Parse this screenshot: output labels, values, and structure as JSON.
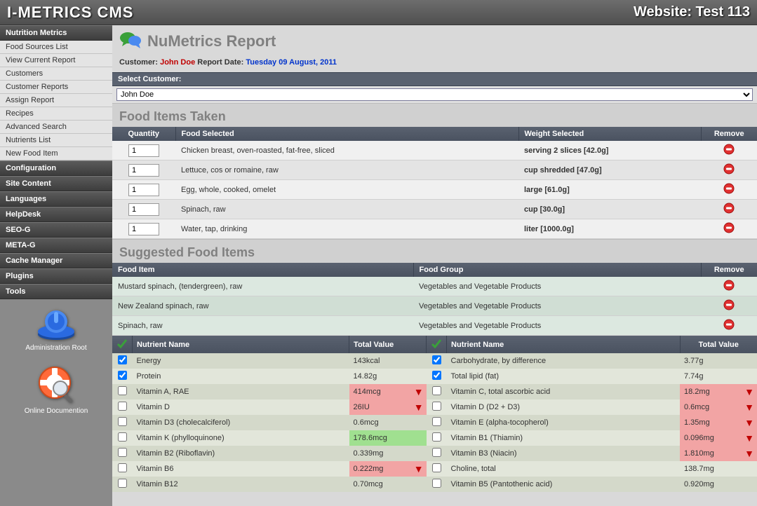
{
  "header": {
    "brand": "I-METRICS CMS",
    "site": "Website: Test 113"
  },
  "sidebar": {
    "sections": [
      {
        "title": "Nutrition Metrics",
        "items": [
          "Food Sources List",
          "View Current Report",
          "Customers",
          "Customer Reports",
          "Assign Report",
          "Recipes",
          "Advanced Search",
          "Nutrients List",
          "New Food Item"
        ]
      },
      {
        "title": "Configuration",
        "items": []
      },
      {
        "title": "Site Content",
        "items": []
      },
      {
        "title": "Languages",
        "items": []
      },
      {
        "title": "HelpDesk",
        "items": []
      },
      {
        "title": "SEO-G",
        "items": []
      },
      {
        "title": "META-G",
        "items": []
      },
      {
        "title": "Cache Manager",
        "items": []
      },
      {
        "title": "Plugins",
        "items": []
      },
      {
        "title": "Tools",
        "items": []
      }
    ],
    "footer1": "Administration Root",
    "footer2": "Online Documention"
  },
  "page": {
    "title": "NuMetrics Report",
    "customer_label": "Customer:",
    "customer_name": "John Doe",
    "date_label": "Report Date:",
    "date_value": "Tuesday 09 August, 2011",
    "select_label": "Select Customer:",
    "select_value": "John Doe"
  },
  "food_taken": {
    "title": "Food Items Taken",
    "cols": {
      "qty": "Quantity",
      "food": "Food Selected",
      "weight": "Weight Selected",
      "remove": "Remove"
    },
    "rows": [
      {
        "qty": "1",
        "food": "Chicken breast, oven-roasted, fat-free, sliced",
        "weight": "serving 2 slices [42.0g]"
      },
      {
        "qty": "1",
        "food": "Lettuce, cos or romaine, raw",
        "weight": "cup shredded [47.0g]"
      },
      {
        "qty": "1",
        "food": "Egg, whole, cooked, omelet",
        "weight": "large [61.0g]"
      },
      {
        "qty": "1",
        "food": "Spinach, raw",
        "weight": "cup [30.0g]"
      },
      {
        "qty": "1",
        "food": "Water, tap, drinking",
        "weight": "liter [1000.0g]"
      }
    ]
  },
  "suggested": {
    "title": "Suggested Food Items",
    "cols": {
      "item": "Food Item",
      "group": "Food Group",
      "remove": "Remove"
    },
    "rows": [
      {
        "item": "Mustard spinach, (tendergreen), raw",
        "group": "Vegetables and Vegetable Products"
      },
      {
        "item": "New Zealand spinach, raw",
        "group": "Vegetables and Vegetable Products"
      },
      {
        "item": "Spinach, raw",
        "group": "Vegetables and Vegetable Products"
      }
    ]
  },
  "nutrients": {
    "cols": {
      "name": "Nutrient Name",
      "value": "Total Value"
    },
    "pairs": [
      {
        "l": {
          "chk": true,
          "name": "Energy",
          "val": "143kcal",
          "status": ""
        },
        "r": {
          "chk": true,
          "name": "Carbohydrate, by difference",
          "val": "3.77g",
          "status": ""
        }
      },
      {
        "l": {
          "chk": true,
          "name": "Protein",
          "val": "14.82g",
          "status": ""
        },
        "r": {
          "chk": true,
          "name": "Total lipid (fat)",
          "val": "7.74g",
          "status": ""
        }
      },
      {
        "l": {
          "chk": false,
          "name": "Vitamin A, RAE",
          "val": "414mcg",
          "status": "low"
        },
        "r": {
          "chk": false,
          "name": "Vitamin C, total ascorbic acid",
          "val": "18.2mg",
          "status": "low"
        }
      },
      {
        "l": {
          "chk": false,
          "name": "Vitamin D",
          "val": "26IU",
          "status": "low"
        },
        "r": {
          "chk": false,
          "name": "Vitamin D (D2 + D3)",
          "val": "0.6mcg",
          "status": "low"
        }
      },
      {
        "l": {
          "chk": false,
          "name": "Vitamin D3 (cholecalciferol)",
          "val": "0.6mcg",
          "status": ""
        },
        "r": {
          "chk": false,
          "name": "Vitamin E (alpha-tocopherol)",
          "val": "1.35mg",
          "status": "low"
        }
      },
      {
        "l": {
          "chk": false,
          "name": "Vitamin K (phylloquinone)",
          "val": "178.6mcg",
          "status": "ok"
        },
        "r": {
          "chk": false,
          "name": "Vitamin B1 (Thiamin)",
          "val": "0.096mg",
          "status": "low"
        }
      },
      {
        "l": {
          "chk": false,
          "name": "Vitamin B2 (Riboflavin)",
          "val": "0.339mg",
          "status": ""
        },
        "r": {
          "chk": false,
          "name": "Vitamin B3 (Niacin)",
          "val": "1.810mg",
          "status": "low"
        }
      },
      {
        "l": {
          "chk": false,
          "name": "Vitamin B6",
          "val": "0.222mg",
          "status": "low"
        },
        "r": {
          "chk": false,
          "name": "Choline, total",
          "val": "138.7mg",
          "status": ""
        }
      },
      {
        "l": {
          "chk": false,
          "name": "Vitamin B12",
          "val": "0.70mcg",
          "status": ""
        },
        "r": {
          "chk": false,
          "name": "Vitamin B5 (Pantothenic acid)",
          "val": "0.920mg",
          "status": ""
        }
      }
    ]
  }
}
